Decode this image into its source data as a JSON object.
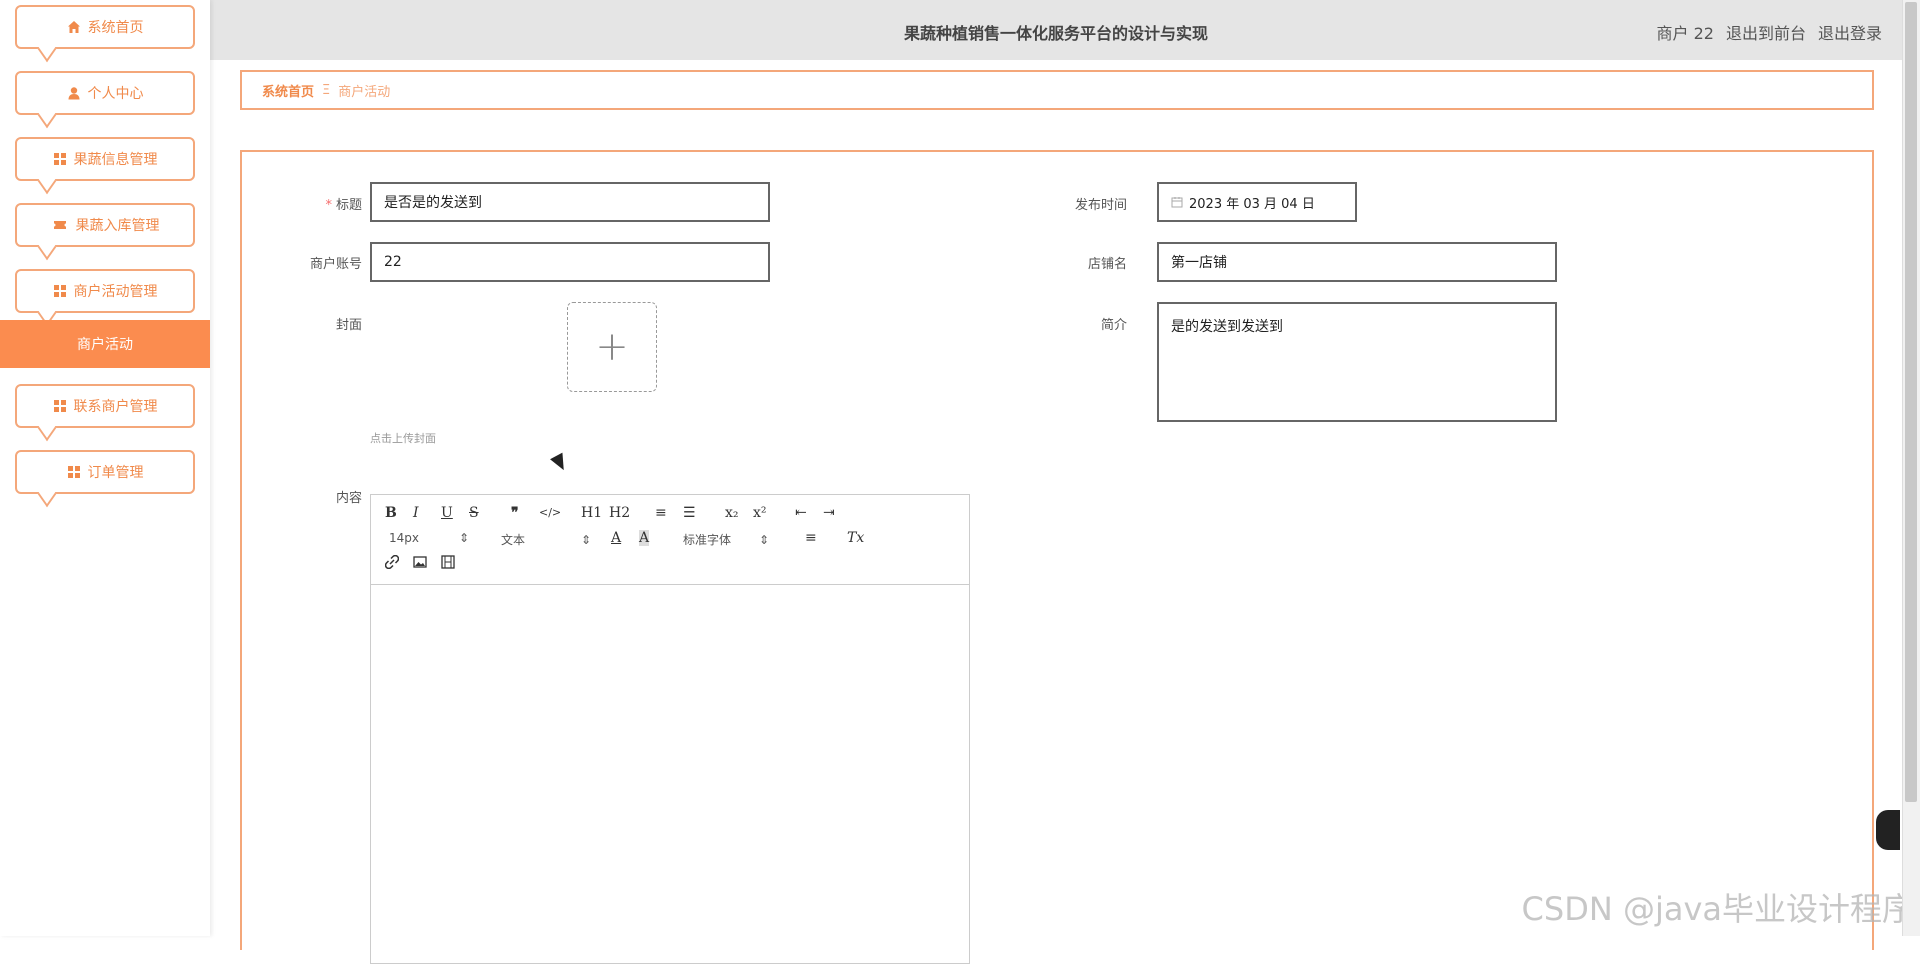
{
  "header": {
    "title": "果蔬种植销售一体化服务平台的设计与实现",
    "user": "商户 22",
    "to_front": "退出到前台",
    "logout": "退出登录"
  },
  "sidebar": {
    "items": [
      {
        "label": "系统首页",
        "icon": "home-icon"
      },
      {
        "label": "个人中心",
        "icon": "user-icon"
      },
      {
        "label": "果蔬信息管理",
        "icon": "grid-icon"
      },
      {
        "label": "果蔬入库管理",
        "icon": "ticket-icon"
      },
      {
        "label": "商户活动管理",
        "icon": "grid-icon"
      },
      {
        "label": "联系商户管理",
        "icon": "grid-icon"
      },
      {
        "label": "订单管理",
        "icon": "grid-icon"
      }
    ],
    "active_sub": "商户活动"
  },
  "breadcrumb": {
    "home": "系统首页",
    "separator": "Ξ",
    "current": "商户活动"
  },
  "form": {
    "title_label": "标题",
    "title_required": "*",
    "title_value": "是否是的发送到",
    "publish_time_label": "发布时间",
    "publish_time_value": "2023 年 03 月 04 日",
    "account_label": "商户账号",
    "account_value": "22",
    "shop_label": "店铺名",
    "shop_value": "第一店铺",
    "cover_label": "封面",
    "cover_hint": "点击上传封面",
    "intro_label": "简介",
    "intro_value": "是的发送到发送到",
    "content_label": "内容"
  },
  "editor": {
    "buttons_row1": [
      "B",
      "I",
      "U",
      "S",
      "❞",
      "</>",
      "H1",
      "H2",
      "≡",
      "☰",
      "x₂",
      "x²",
      "⇤",
      "⇥"
    ],
    "font_size": "14px",
    "paragraph": "文本",
    "font_family": "标准字体",
    "color_btn": "A",
    "bg_btn": "A",
    "align_btn": "≡",
    "clear_btn": "Tx"
  },
  "watermark": "CSDN @java毕业设计程序",
  "colors": {
    "accent": "#fb8c4f",
    "border": "#f4a77a",
    "header_bg": "#e5e5e5"
  }
}
